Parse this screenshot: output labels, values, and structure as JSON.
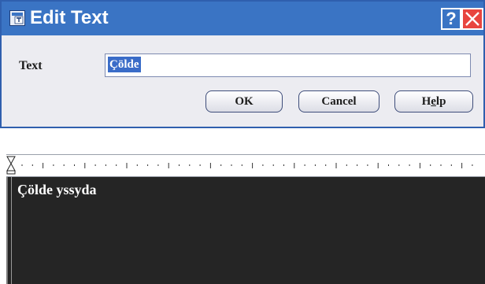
{
  "dialog": {
    "title": "Edit Text",
    "help_glyph": "?",
    "field_label": "Text",
    "field_value": "Çölde",
    "buttons": {
      "ok": "OK",
      "cancel": "Cancel",
      "help_prefix": "H",
      "help_underlined": "e",
      "help_suffix": "lp"
    }
  },
  "editor": {
    "content": "Çölde yssyda"
  },
  "icons": {
    "title": "edit-text-icon",
    "help": "question-icon",
    "close": "close-icon",
    "indent_marker": "indent-marker-icon"
  },
  "colors": {
    "titlebar": "#3a74c4",
    "close_button": "#e8453f",
    "selection": "#3a6cc8",
    "editor_background": "#252525"
  }
}
